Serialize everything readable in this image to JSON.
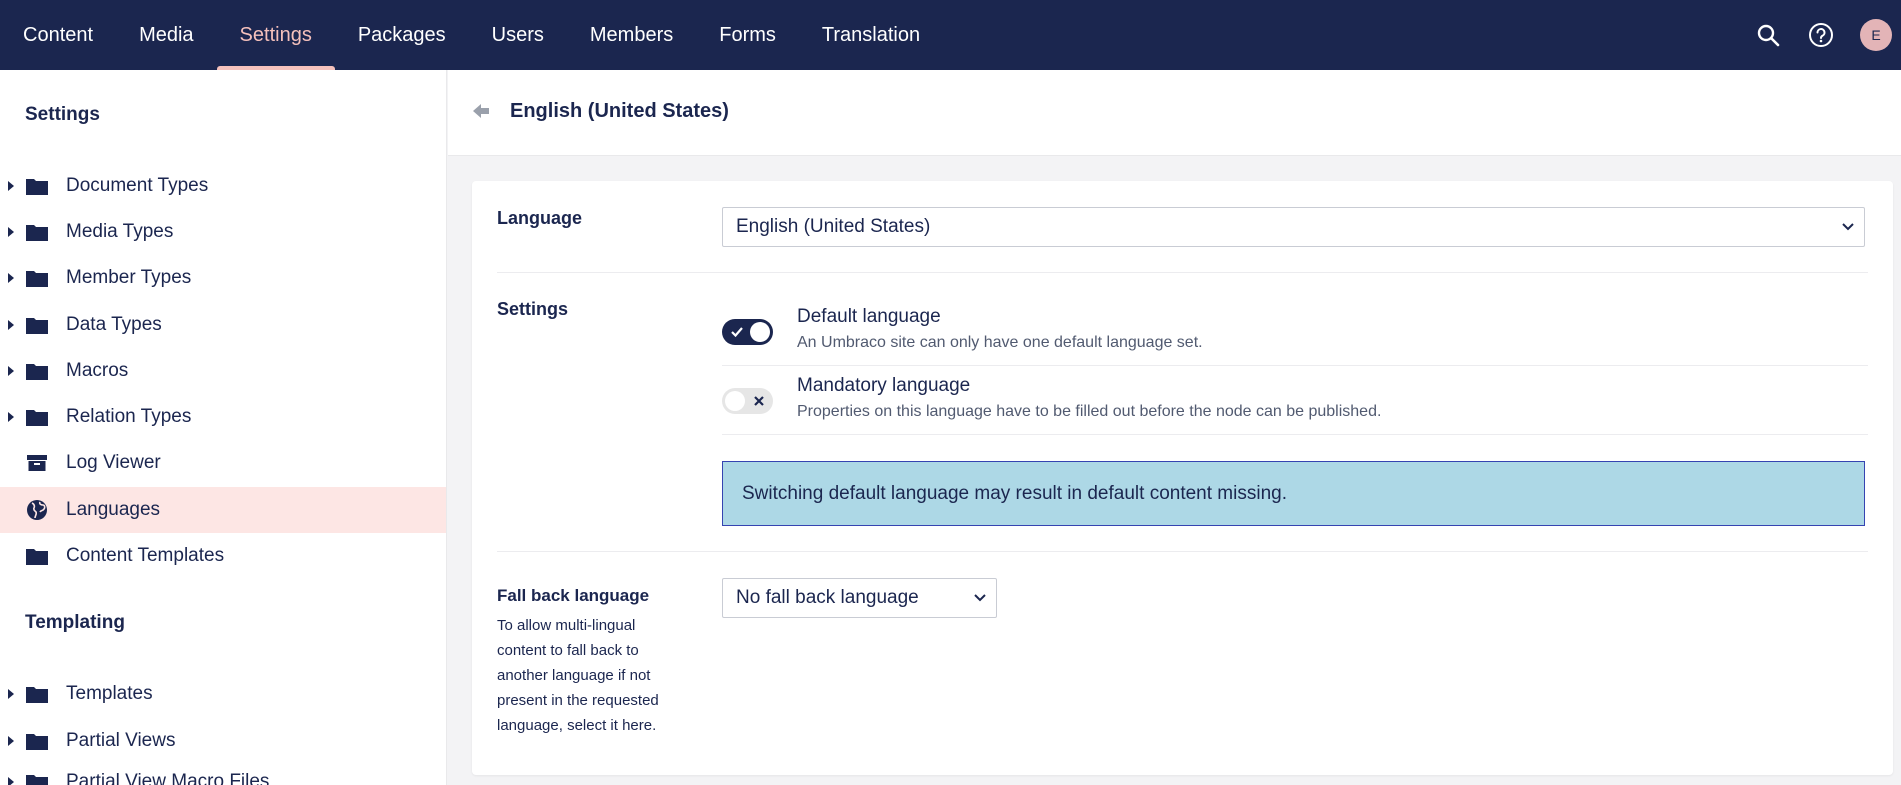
{
  "topnav": {
    "items": [
      {
        "label": "Content"
      },
      {
        "label": "Media"
      },
      {
        "label": "Settings"
      },
      {
        "label": "Packages"
      },
      {
        "label": "Users"
      },
      {
        "label": "Members"
      },
      {
        "label": "Forms"
      },
      {
        "label": "Translation"
      }
    ],
    "active_index": 2,
    "avatar_initial": "E",
    "icons": [
      "search-icon",
      "help-icon"
    ]
  },
  "sidebar": {
    "settings_title": "Settings",
    "settings_items": [
      {
        "label": "Document Types",
        "icon": "folder-icon",
        "expandable": true
      },
      {
        "label": "Media Types",
        "icon": "folder-icon",
        "expandable": true
      },
      {
        "label": "Member Types",
        "icon": "folder-icon",
        "expandable": true
      },
      {
        "label": "Data Types",
        "icon": "folder-icon",
        "expandable": true
      },
      {
        "label": "Macros",
        "icon": "folder-icon",
        "expandable": true
      },
      {
        "label": "Relation Types",
        "icon": "folder-icon",
        "expandable": true
      },
      {
        "label": "Log Viewer",
        "icon": "box-icon",
        "expandable": false
      },
      {
        "label": "Languages",
        "icon": "globe-icon",
        "expandable": false,
        "active": true
      },
      {
        "label": "Content Templates",
        "icon": "folder-icon",
        "expandable": false
      }
    ],
    "templating_title": "Templating",
    "templating_items": [
      {
        "label": "Templates",
        "icon": "folder-icon",
        "expandable": true
      },
      {
        "label": "Partial Views",
        "icon": "folder-icon",
        "expandable": true
      },
      {
        "label": "Partial View Macro Files",
        "icon": "folder-icon",
        "expandable": true
      }
    ]
  },
  "header": {
    "title": "English (United States)"
  },
  "form": {
    "language_label": "Language",
    "language_value": "English (United States)",
    "settings_label": "Settings",
    "default_language": {
      "title": "Default language",
      "description": "An Umbraco site can only have one default language set.",
      "enabled": true
    },
    "mandatory_language": {
      "title": "Mandatory language",
      "description": "Properties on this language have to be filled out before the node can be published.",
      "enabled": false
    },
    "alert_text": "Switching default language may result in default content missing.",
    "fallback_label": "Fall back language",
    "fallback_description": "To allow multi-lingual content to fall back to another language if not present in the requested language, select it here.",
    "fallback_value": "No fall back language"
  },
  "colors": {
    "navy": "#1b264f",
    "accent_pink": "#f5c1bc",
    "active_row": "#fde6e4",
    "alert_bg": "#add8e6",
    "alert_border": "#3544b1"
  }
}
